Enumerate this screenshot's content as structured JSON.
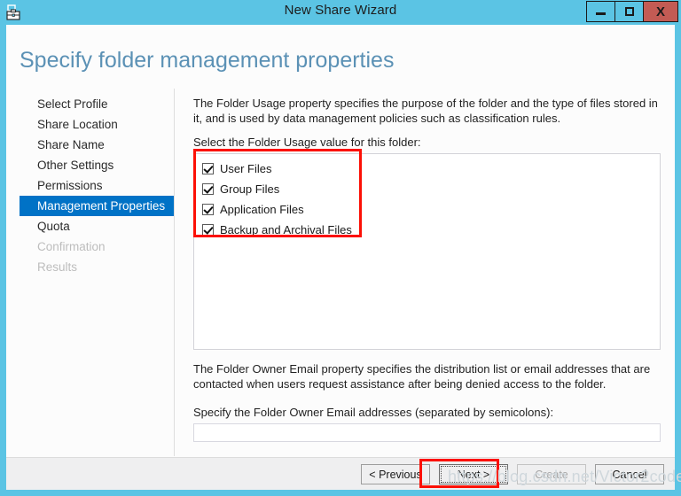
{
  "window": {
    "title": "New Share Wizard",
    "icon": "share-server-icon",
    "controls": {
      "minimize": "minimize-icon",
      "maximize": "maximize-icon",
      "close": "X"
    },
    "accent_color": "#5bc4e4",
    "close_color": "#c35b54"
  },
  "page": {
    "heading": "Specify folder management properties",
    "heading_color": "#5b91b5"
  },
  "nav": {
    "items": [
      {
        "label": "Select Profile",
        "state": "done"
      },
      {
        "label": "Share Location",
        "state": "done"
      },
      {
        "label": "Share Name",
        "state": "done"
      },
      {
        "label": "Other Settings",
        "state": "done"
      },
      {
        "label": "Permissions",
        "state": "done"
      },
      {
        "label": "Management Properties",
        "state": "active"
      },
      {
        "label": "Quota",
        "state": "done"
      },
      {
        "label": "Confirmation",
        "state": "disabled"
      },
      {
        "label": "Results",
        "state": "disabled"
      }
    ],
    "active_color": "#0072c6"
  },
  "main": {
    "folder_usage_description": "The Folder Usage property specifies the purpose of the folder and the type of files stored in it, and is used by data management policies such as classification rules.",
    "folder_usage_label": "Select the Folder Usage value for this folder:",
    "folder_usage_options": [
      {
        "label": "User Files",
        "checked": true
      },
      {
        "label": "Group Files",
        "checked": true
      },
      {
        "label": "Application Files",
        "checked": true
      },
      {
        "label": "Backup and Archival Files",
        "checked": true
      }
    ],
    "owner_email_description": "The Folder Owner Email property specifies the distribution list or email addresses that are contacted when users request assistance after being denied access to the folder.",
    "owner_email_label": "Specify the Folder Owner Email addresses (separated by semicolons):",
    "owner_email_value": "",
    "owner_email_placeholder": ""
  },
  "footer": {
    "previous_label": "< Previous",
    "next_label": "Next >",
    "create_label": "Create",
    "cancel_label": "Cancel"
  },
  "annotations": {
    "color": "#fc1005",
    "highlight_checkboxes": "folder-usage-options",
    "highlight_next": "next-button"
  },
  "watermark": {
    "text": "https://blog.csdn.net/Victor2code"
  }
}
